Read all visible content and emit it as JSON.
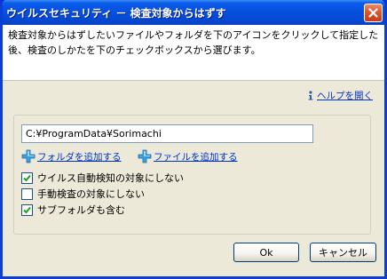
{
  "window": {
    "title": "ウイルスセキュリティ － 検査対象からはずす"
  },
  "description": "検査対象からはずしたいファイルやフォルダを下のアイコンをクリックして指定した後、検査のしかたを下のチェックボックスから選びます。",
  "help_link": "ヘルプを開く",
  "path_input": {
    "value": "C:¥ProgramData¥Sorimachi"
  },
  "add_folder_link": "フォルダを追加する",
  "add_file_link": "ファイルを追加する",
  "options": [
    {
      "label": "ウイルス自動検知の対象にしない",
      "checked": true
    },
    {
      "label": "手動検査の対象にしない",
      "checked": false
    },
    {
      "label": "サブフォルダも含む",
      "checked": true
    }
  ],
  "buttons": {
    "ok": "Ok",
    "cancel": "キャンセル"
  },
  "colors": {
    "link": "#0033cc",
    "titlebar": "#0650e0",
    "close": "#e2542c",
    "add_icon": "#3aa0e0"
  },
  "icons": {
    "close": "close-icon",
    "help": "help-info-icon",
    "add": "plus-add-icon",
    "check": "checkmark-icon"
  }
}
